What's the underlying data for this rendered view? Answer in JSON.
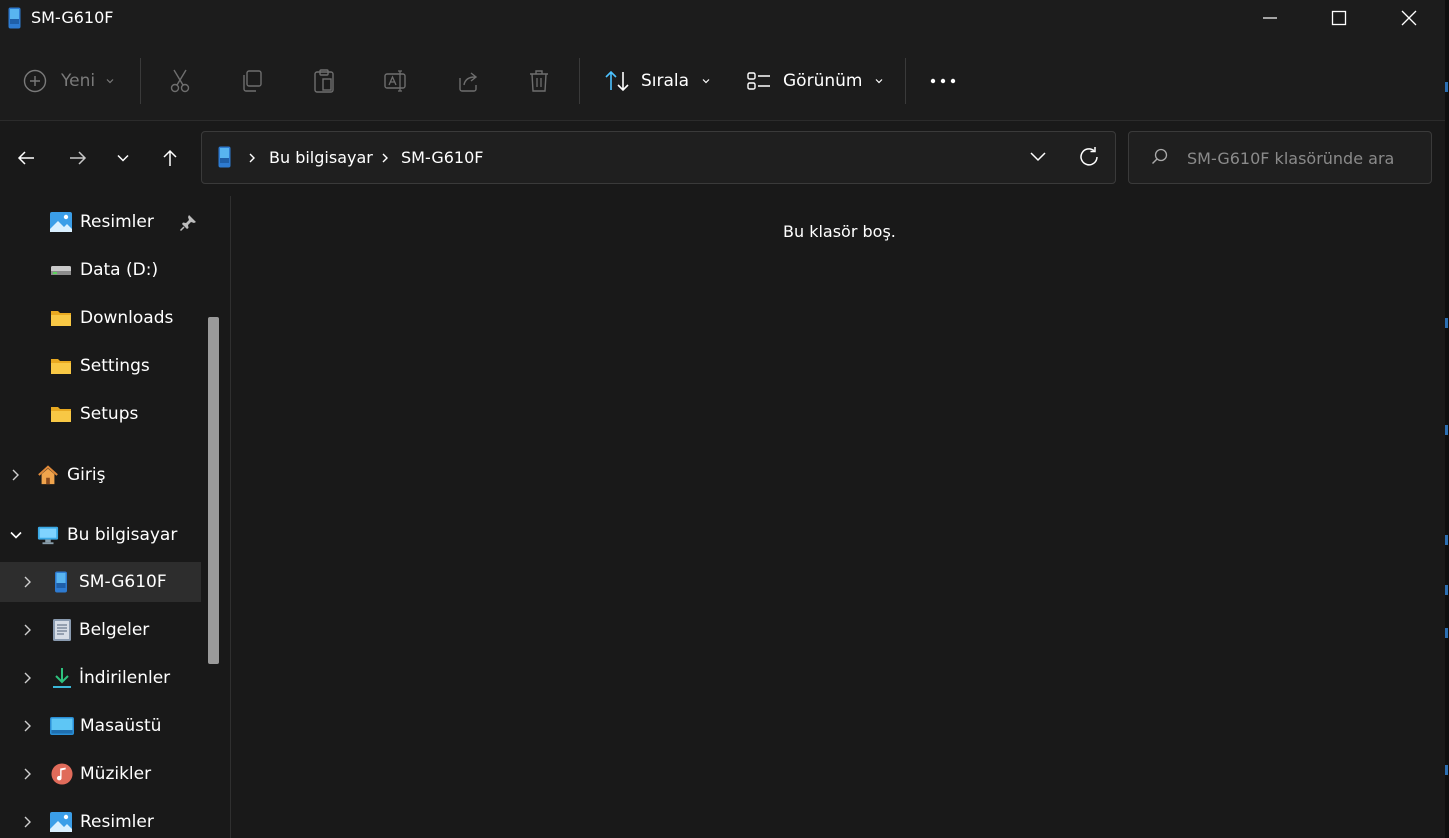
{
  "window": {
    "title": "SM-G610F",
    "controls": {
      "minimize": "minimize",
      "maximize": "maximize",
      "close": "close"
    }
  },
  "toolbar": {
    "new_label": "Yeni",
    "sort_label": "Sırala",
    "view_label": "Görünüm",
    "disabled_actions": [
      "cut-icon",
      "copy-icon",
      "paste-icon",
      "rename-icon",
      "share-icon",
      "delete-icon"
    ],
    "more_icon": "more-icon"
  },
  "address": {
    "crumbs": [
      "Bu bilgisayar",
      "SM-G610F"
    ]
  },
  "search": {
    "placeholder": "SM-G610F klasöründe ara"
  },
  "sidebar": {
    "quick_access": [
      {
        "label": "Resimler",
        "icon": "pictures-icon",
        "pinned": true
      },
      {
        "label": "Data (D:)",
        "icon": "drive-icon"
      },
      {
        "label": "Downloads",
        "icon": "folder-icon"
      },
      {
        "label": "Settings",
        "icon": "folder-icon"
      },
      {
        "label": "Setups",
        "icon": "folder-icon"
      }
    ],
    "home": {
      "label": "Giriş",
      "icon": "home-icon"
    },
    "this_pc": {
      "label": "Bu bilgisayar",
      "icon": "computer-icon",
      "expanded": true
    },
    "this_pc_children": [
      {
        "label": "SM-G610F",
        "icon": "phone-icon",
        "selected": true
      },
      {
        "label": "Belgeler",
        "icon": "documents-icon"
      },
      {
        "label": "İndirilenler",
        "icon": "downloads-icon"
      },
      {
        "label": "Masaüstü",
        "icon": "desktop-icon"
      },
      {
        "label": "Müzikler",
        "icon": "music-icon"
      },
      {
        "label": "Resimler",
        "icon": "pictures-icon"
      }
    ]
  },
  "content": {
    "empty_message": "Bu klasör boş."
  },
  "colors": {
    "background": "#191919",
    "selection": "#2d2d2d",
    "folder": "#f8c845",
    "accent": "#4cc2ff"
  }
}
